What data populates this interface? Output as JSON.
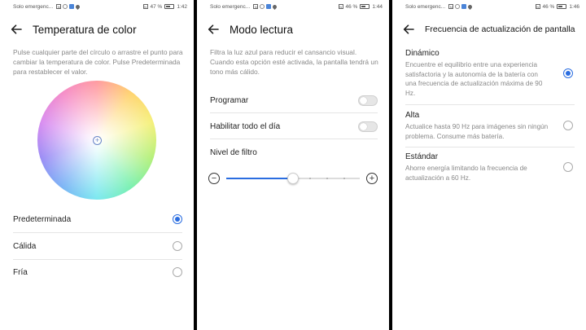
{
  "screens": [
    {
      "status": {
        "carrier": "Solo emergenc...",
        "battery": "47 %",
        "time": "1:42"
      },
      "title": "Temperatura de color",
      "description": "Pulse cualquier parte del círculo o arrastre el punto para cambiar la temperatura de color. Pulse Predeterminada para restablecer el valor.",
      "options": [
        {
          "label": "Predeterminada",
          "selected": true
        },
        {
          "label": "Cálida",
          "selected": false
        },
        {
          "label": "Fría",
          "selected": false
        }
      ]
    },
    {
      "status": {
        "carrier": "Solo emergenc...",
        "battery": "46 %",
        "time": "1:44"
      },
      "title": "Modo lectura",
      "description": "Filtra la luz azul para reducir el cansancio visual. Cuando esta opción esté activada, la pantalla tendrá un tono más cálido.",
      "toggles": [
        {
          "label": "Programar",
          "on": false
        },
        {
          "label": "Habilitar todo el día",
          "on": false
        }
      ],
      "filter_label": "Nivel de filtro",
      "filter_level": 0.5
    },
    {
      "status": {
        "carrier": "Solo emergenc...",
        "battery": "46 %",
        "time": "1:46"
      },
      "title": "Frecuencia de actualización de pantalla",
      "options": [
        {
          "name": "Dinámico",
          "text": "Encuentre el equilibrio entre una experiencia satisfactoria y la autonomía de la batería con una frecuencia de actualización máxima de 90 Hz.",
          "selected": true
        },
        {
          "name": "Alta",
          "text": "Actualice hasta 90 Hz para imágenes sin ningún problema. Consume más batería.",
          "selected": false
        },
        {
          "name": "Estándar",
          "text": "Ahorre energía limitando la frecuencia de actualización a 60 Hz.",
          "selected": false
        }
      ]
    }
  ],
  "colors": {
    "accent": "#2a6de0",
    "divider": "#000000"
  }
}
